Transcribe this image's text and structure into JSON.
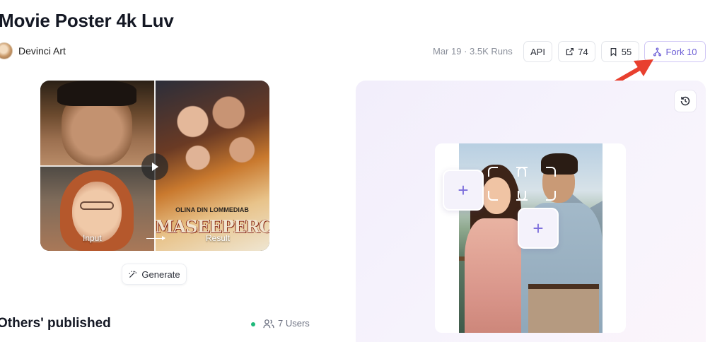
{
  "header": {
    "title": "Movie Poster 4k Luv",
    "author": "Devinci Art",
    "meta": "Mar 19 · 3.5K Runs"
  },
  "actions": {
    "api_label": "API",
    "share_count": "74",
    "save_count": "55",
    "fork_label": "Fork 10"
  },
  "preview": {
    "poster_subtitle": "OLINA DIN LOMMEDIAB",
    "poster_text": "MASEEPERCII",
    "input_caption": "Input",
    "result_caption": "Result"
  },
  "generate": {
    "label": "Generate"
  },
  "others": {
    "heading": "Others' published",
    "users_label": "7 Users"
  },
  "colors": {
    "accent": "#6d5fd6",
    "annotation_arrow": "#e8402f",
    "status_dot": "#1fb97a"
  }
}
